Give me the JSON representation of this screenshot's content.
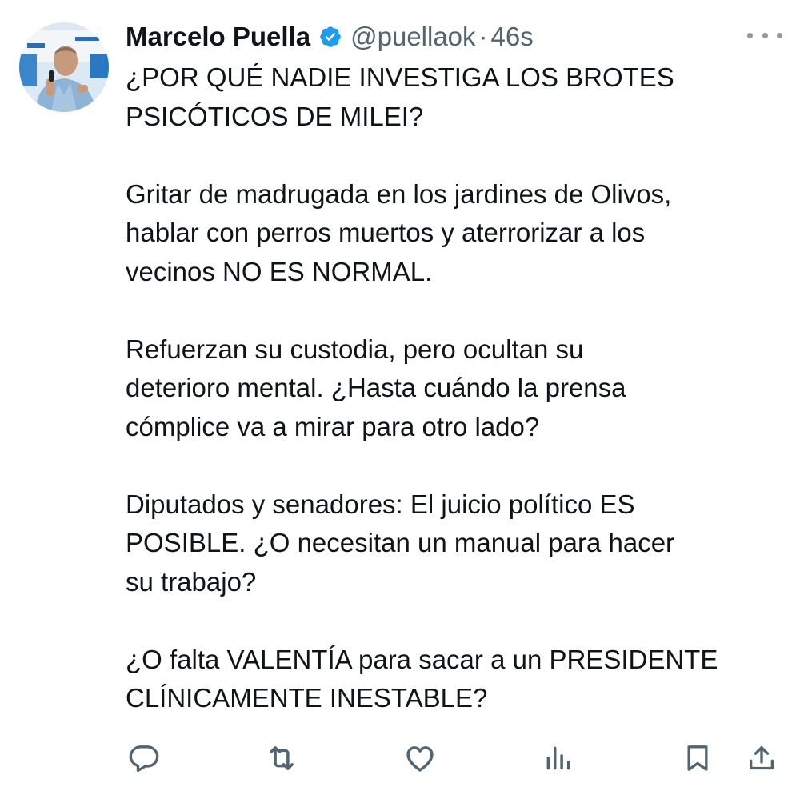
{
  "tweet": {
    "author": {
      "display_name": "Marcelo Puella",
      "handle": "@puellaok",
      "verified": true,
      "avatar_icon": "profile-photo"
    },
    "separator": "·",
    "time_ago": "46s",
    "paragraphs": [
      [
        "¿POR QUÉ NADIE INVESTIGA LOS BROTES",
        "PSICÓTICOS DE MILEI?"
      ],
      [
        "Gritar de madrugada en los jardines de Olivos,",
        "hablar con perros muertos y aterrorizar a los",
        "vecinos NO ES NORMAL."
      ],
      [
        "Refuerzan su custodia, pero ocultan su",
        "deterioro mental. ¿Hasta cuándo la prensa",
        "cómplice va a mirar para otro lado?"
      ],
      [
        "Diputados y senadores: El juicio político ES",
        "POSIBLE. ¿O necesitan un manual para hacer",
        "su trabajo?"
      ],
      [
        "¿O falta VALENTÍA para sacar a un PRESIDENTE",
        "CLÍNICAMENTE INESTABLE?"
      ]
    ],
    "actions": [
      {
        "name": "reply",
        "icon": "reply-icon"
      },
      {
        "name": "retweet",
        "icon": "retweet-icon"
      },
      {
        "name": "like",
        "icon": "heart-icon"
      },
      {
        "name": "views",
        "icon": "analytics-icon"
      },
      {
        "name": "bookmark",
        "icon": "bookmark-icon"
      },
      {
        "name": "share",
        "icon": "share-icon"
      }
    ]
  },
  "colors": {
    "text": "#0f1419",
    "secondary": "#536471",
    "verified": "#1d9bf0",
    "icon": "#536471"
  }
}
